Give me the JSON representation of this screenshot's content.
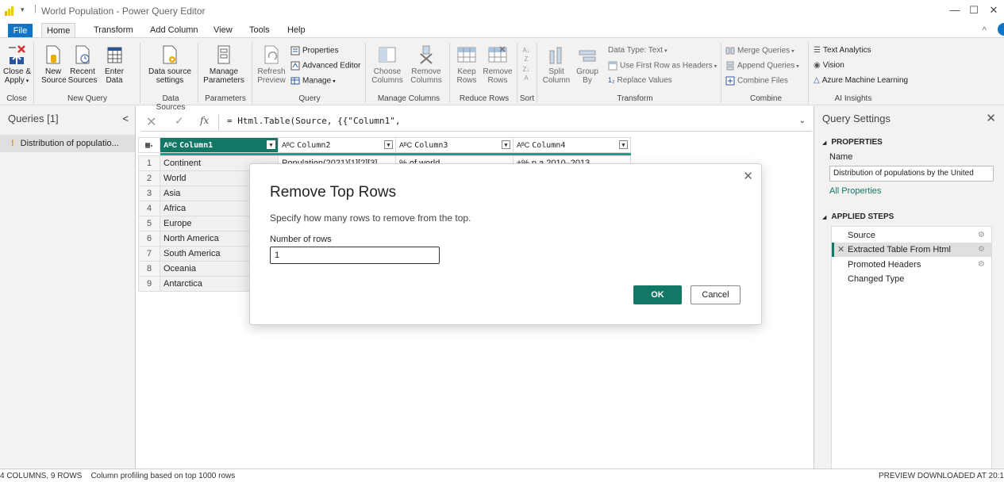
{
  "window": {
    "title": "World Population - Power Query Editor",
    "qa_arrow": "▾",
    "minimize": "—",
    "maximize": "☐",
    "close": "✕"
  },
  "tabs": [
    "File",
    "Home",
    "Transform",
    "Add Column",
    "View",
    "Tools",
    "Help"
  ],
  "ribbon": {
    "close_apply": "Close &\nApply",
    "new_source": "New\nSource",
    "recent_sources": "Recent\nSources",
    "enter_data": "Enter\nData",
    "data_source_settings": "Data source\nsettings",
    "manage_parameters": "Manage\nParameters",
    "refresh_preview": "Refresh\nPreview",
    "properties": "Properties",
    "advanced_editor": "Advanced Editor",
    "manage": "Manage",
    "choose_columns": "Choose\nColumns",
    "remove_columns": "Remove\nColumns",
    "keep_rows": "Keep\nRows",
    "remove_rows": "Remove\nRows",
    "split_column": "Split\nColumn",
    "group_by": "Group\nBy",
    "data_type": "Data Type: Text",
    "use_first_row": "Use First Row as Headers",
    "replace_values": "Replace Values",
    "merge_queries": "Merge Queries",
    "append_queries": "Append Queries",
    "combine_files": "Combine Files",
    "text_analytics": "Text Analytics",
    "vision": "Vision",
    "azure_ml": "Azure Machine Learning",
    "groups": {
      "close": "Close",
      "new_query": "New Query",
      "data_sources": "Data Sources",
      "parameters": "Parameters",
      "query": "Query",
      "manage_columns": "Manage Columns",
      "reduce_rows": "Reduce Rows",
      "sort": "Sort",
      "transform": "Transform",
      "combine": "Combine",
      "ai_insights": "AI Insights"
    }
  },
  "queries": {
    "header": "Queries [1]",
    "items": [
      {
        "label": "Distribution of populatio..."
      }
    ]
  },
  "formula": {
    "text": "= Html.Table(Source, {{\"Column1\","
  },
  "grid": {
    "columns": [
      "Column1",
      "Column2",
      "Column3",
      "Column4"
    ],
    "row1": [
      "1",
      "Continent",
      "Population(2021)[1][2][3]",
      "% of world",
      "±% p.a 2010–2013"
    ],
    "rows": [
      [
        "2",
        "World"
      ],
      [
        "3",
        "Asia"
      ],
      [
        "4",
        "Africa"
      ],
      [
        "5",
        "Europe"
      ],
      [
        "6",
        "North America"
      ],
      [
        "7",
        "South America"
      ],
      [
        "8",
        "Oceania"
      ],
      [
        "9",
        "Antarctica"
      ]
    ]
  },
  "dialog": {
    "title": "Remove Top Rows",
    "description": "Specify how many rows to remove from the top.",
    "field_label": "Number of rows",
    "field_value": "1",
    "ok": "OK",
    "cancel": "Cancel"
  },
  "settings": {
    "header": "Query Settings",
    "properties": "PROPERTIES",
    "name_label": "Name",
    "name_value": "Distribution of populations by the United",
    "all_properties": "All Properties",
    "applied_steps": "APPLIED STEPS",
    "steps": [
      {
        "label": "Source"
      },
      {
        "label": "Extracted Table From Html"
      },
      {
        "label": "Promoted Headers"
      },
      {
        "label": "Changed Type"
      }
    ]
  },
  "status": {
    "left": "4 COLUMNS, 9 ROWS    Column profiling based on top 1000 rows",
    "right": "PREVIEW DOWNLOADED AT 20:1"
  },
  "colors": {
    "accent": "#117865",
    "file_tab": "#1175c7",
    "warning": "#d59400"
  }
}
